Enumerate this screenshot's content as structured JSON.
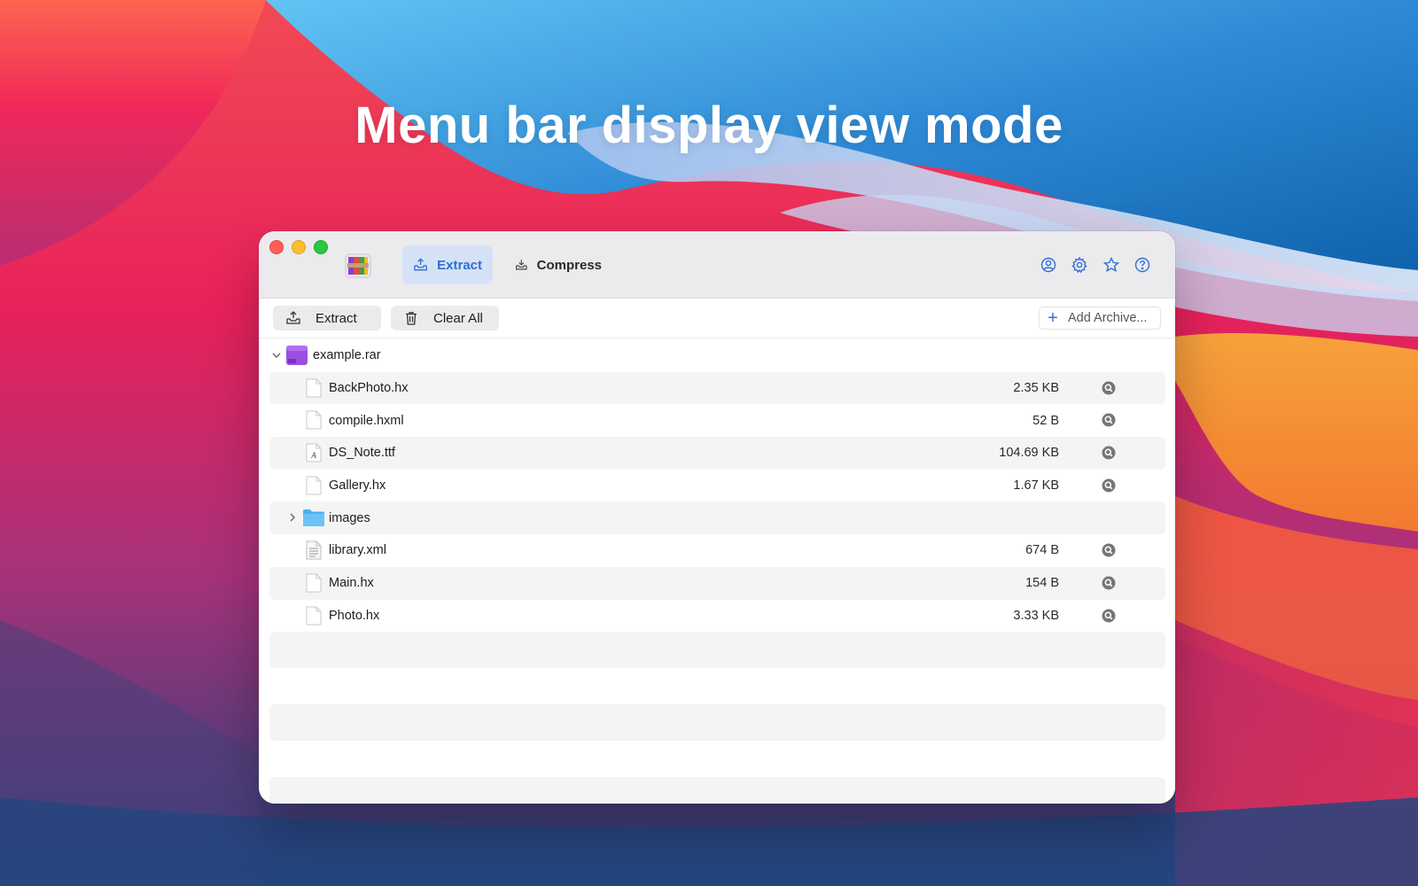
{
  "headline": "Menu bar display view mode",
  "colors": {
    "accent": "#2e6fd6",
    "active_tab_bg": "#d5e2f6"
  },
  "app": {
    "icon": "winrar-books-icon",
    "tabs": [
      {
        "label": "Extract",
        "icon": "extract-tray-icon",
        "active": true
      },
      {
        "label": "Compress",
        "icon": "compress-tray-icon",
        "active": false
      }
    ],
    "titlebar_icons": [
      "account-icon",
      "settings-gear-icon",
      "star-icon",
      "help-icon"
    ]
  },
  "toolbar": {
    "extract_label": "Extract",
    "clear_label": "Clear All",
    "add_archive_label": "Add Archive..."
  },
  "tree": {
    "archive": {
      "name": "example.rar",
      "expanded": true
    },
    "items": [
      {
        "name": "BackPhoto.hx",
        "size": "2.35 KB",
        "kind": "file"
      },
      {
        "name": "compile.hxml",
        "size": "52 B",
        "kind": "file"
      },
      {
        "name": "DS_Note.ttf",
        "size": "104.69 KB",
        "kind": "font"
      },
      {
        "name": "Gallery.hx",
        "size": "1.67 KB",
        "kind": "file"
      },
      {
        "name": "images",
        "size": "",
        "kind": "folder"
      },
      {
        "name": "library.xml",
        "size": "674 B",
        "kind": "text"
      },
      {
        "name": "Main.hx",
        "size": "154 B",
        "kind": "file"
      },
      {
        "name": "Photo.hx",
        "size": "3.33 KB",
        "kind": "file"
      }
    ]
  }
}
